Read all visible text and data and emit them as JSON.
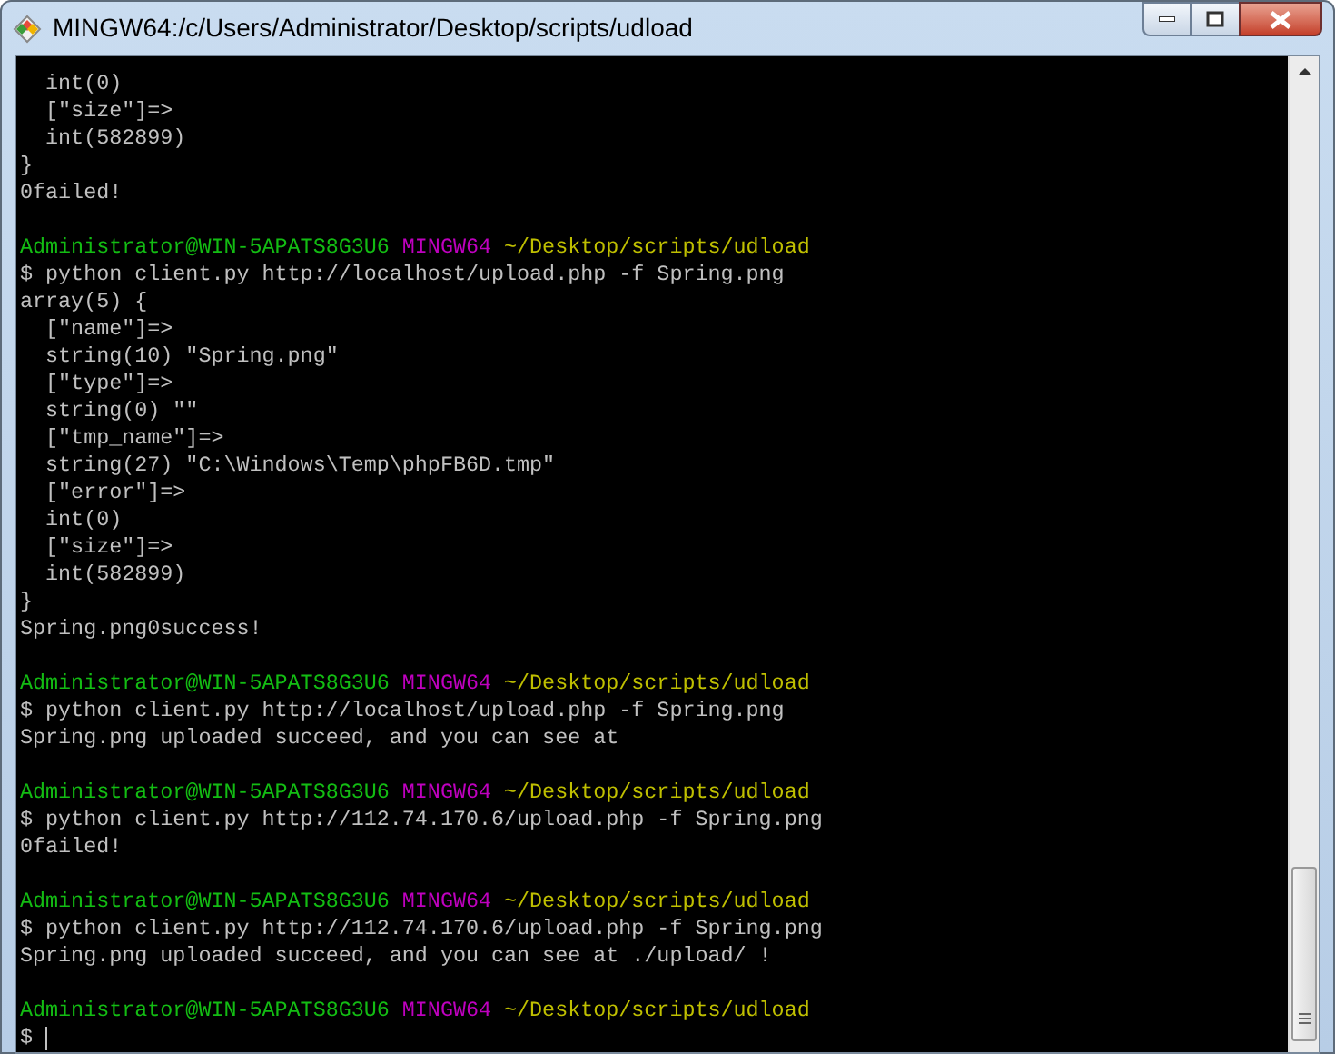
{
  "window": {
    "title": "MINGW64:/c/Users/Administrator/Desktop/scripts/udload"
  },
  "terminal": {
    "lines": [
      {
        "kind": "text",
        "text": "  int(0)"
      },
      {
        "kind": "text",
        "text": "  [\"size\"]=>"
      },
      {
        "kind": "text",
        "text": "  int(582899)"
      },
      {
        "kind": "text",
        "text": "}"
      },
      {
        "kind": "text",
        "text": "0failed!"
      },
      {
        "kind": "blank"
      },
      {
        "kind": "prompt",
        "user": "Administrator@WIN-5APATS8G3U6",
        "system": "MINGW64",
        "path": "~/Desktop/scripts/udload"
      },
      {
        "kind": "text",
        "text": "$ python client.py http://localhost/upload.php -f Spring.png"
      },
      {
        "kind": "text",
        "text": "array(5) {"
      },
      {
        "kind": "text",
        "text": "  [\"name\"]=>"
      },
      {
        "kind": "text",
        "text": "  string(10) \"Spring.png\""
      },
      {
        "kind": "text",
        "text": "  [\"type\"]=>"
      },
      {
        "kind": "text",
        "text": "  string(0) \"\""
      },
      {
        "kind": "text",
        "text": "  [\"tmp_name\"]=>"
      },
      {
        "kind": "text",
        "text": "  string(27) \"C:\\Windows\\Temp\\phpFB6D.tmp\""
      },
      {
        "kind": "text",
        "text": "  [\"error\"]=>"
      },
      {
        "kind": "text",
        "text": "  int(0)"
      },
      {
        "kind": "text",
        "text": "  [\"size\"]=>"
      },
      {
        "kind": "text",
        "text": "  int(582899)"
      },
      {
        "kind": "text",
        "text": "}"
      },
      {
        "kind": "text",
        "text": "Spring.png0success!"
      },
      {
        "kind": "blank"
      },
      {
        "kind": "prompt",
        "user": "Administrator@WIN-5APATS8G3U6",
        "system": "MINGW64",
        "path": "~/Desktop/scripts/udload"
      },
      {
        "kind": "text",
        "text": "$ python client.py http://localhost/upload.php -f Spring.png"
      },
      {
        "kind": "text",
        "text": "Spring.png uploaded succeed, and you can see at"
      },
      {
        "kind": "blank"
      },
      {
        "kind": "prompt",
        "user": "Administrator@WIN-5APATS8G3U6",
        "system": "MINGW64",
        "path": "~/Desktop/scripts/udload"
      },
      {
        "kind": "text",
        "text": "$ python client.py http://112.74.170.6/upload.php -f Spring.png"
      },
      {
        "kind": "text",
        "text": "0failed!"
      },
      {
        "kind": "blank"
      },
      {
        "kind": "prompt",
        "user": "Administrator@WIN-5APATS8G3U6",
        "system": "MINGW64",
        "path": "~/Desktop/scripts/udload"
      },
      {
        "kind": "text",
        "text": "$ python client.py http://112.74.170.6/upload.php -f Spring.png"
      },
      {
        "kind": "text",
        "text": "Spring.png uploaded succeed, and you can see at ./upload/ !"
      },
      {
        "kind": "blank"
      },
      {
        "kind": "prompt",
        "user": "Administrator@WIN-5APATS8G3U6",
        "system": "MINGW64",
        "path": "~/Desktop/scripts/udload"
      },
      {
        "kind": "input",
        "text": "$"
      }
    ]
  }
}
